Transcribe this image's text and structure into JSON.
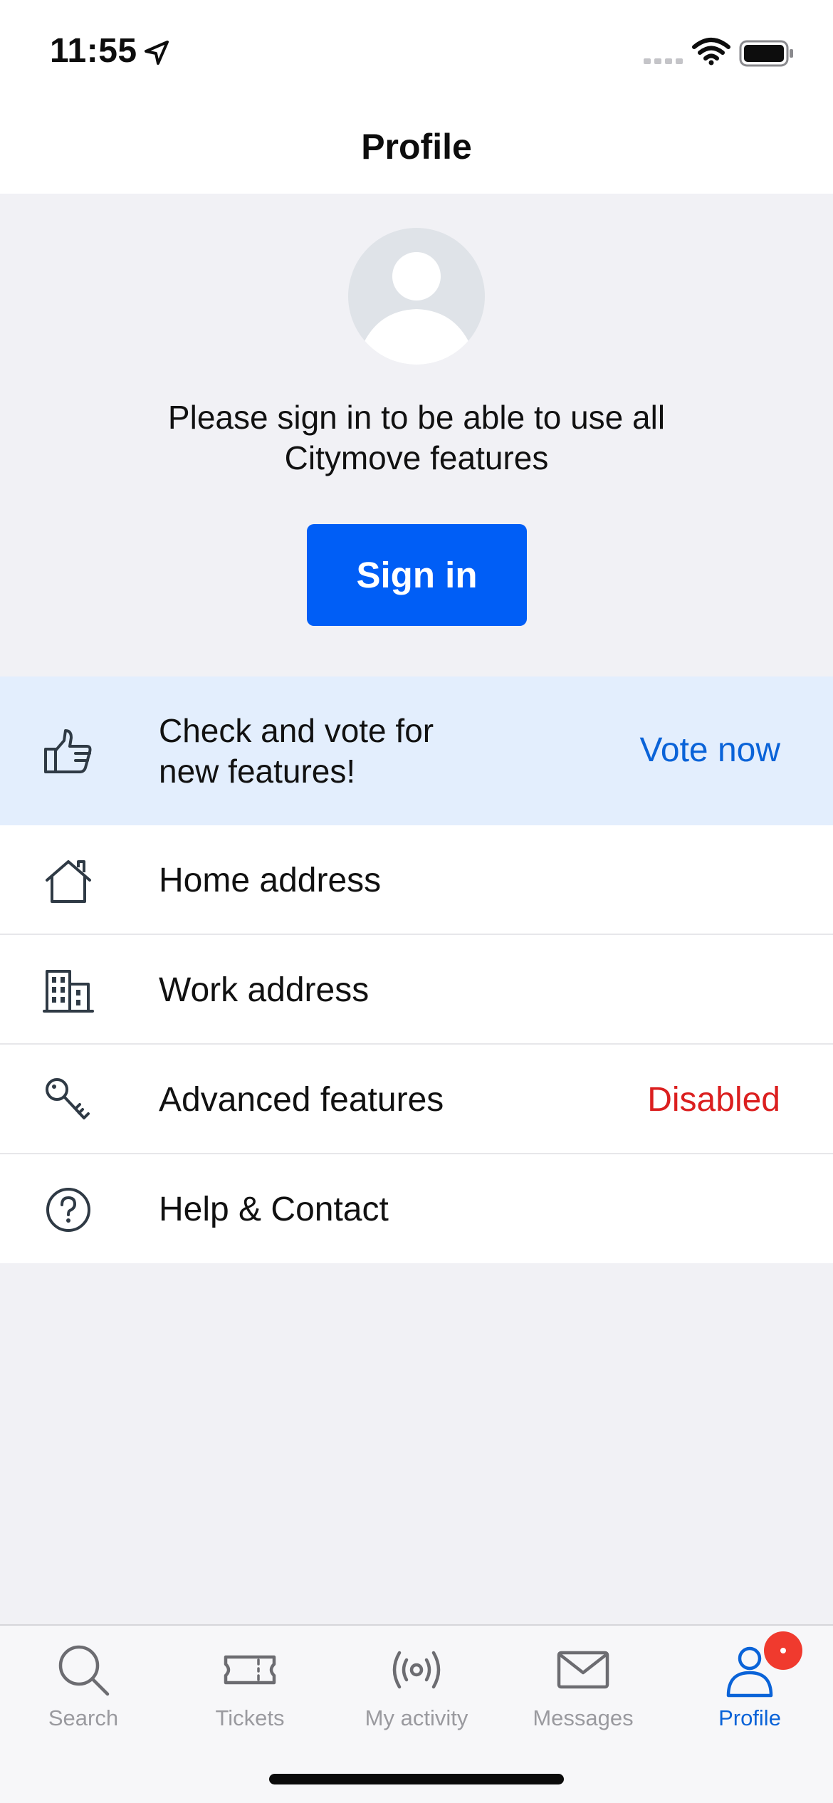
{
  "status_bar": {
    "time": "11:55",
    "icons": [
      "location-arrow-icon",
      "signal-icon",
      "wifi-icon",
      "battery-icon"
    ]
  },
  "header": {
    "title": "Profile"
  },
  "signin": {
    "message_line1": "Please sign in to be able to use all",
    "message_line2": "Citymove features",
    "button_label": "Sign in",
    "button_color": "#005ef6"
  },
  "vote_banner": {
    "text_line1": "Check and vote for",
    "text_line2": "new features!",
    "action_label": "Vote now",
    "icon": "thumbs-up-icon",
    "accent": "#0a63d8",
    "background": "#e3eefd"
  },
  "list": {
    "items": [
      {
        "label": "Home address",
        "icon": "house-icon",
        "value": ""
      },
      {
        "label": "Work address",
        "icon": "building-icon",
        "value": ""
      },
      {
        "label": "Advanced features",
        "icon": "key-icon",
        "value": "Disabled"
      },
      {
        "label": "Help & Contact",
        "icon": "help-circle-icon",
        "value": ""
      }
    ],
    "value_color": "#db1f1f"
  },
  "tab_bar": {
    "tabs": [
      {
        "label": "Search",
        "icon": "search-icon",
        "active": false
      },
      {
        "label": "Tickets",
        "icon": "ticket-icon",
        "active": false
      },
      {
        "label": "My activity",
        "icon": "broadcast-icon",
        "active": false
      },
      {
        "label": "Messages",
        "icon": "envelope-icon",
        "active": false
      },
      {
        "label": "Profile",
        "icon": "person-icon",
        "active": true
      }
    ],
    "active_color": "#0a63d8",
    "inactive_color": "#9a9a9f",
    "badge_color": "#f03a2e"
  }
}
